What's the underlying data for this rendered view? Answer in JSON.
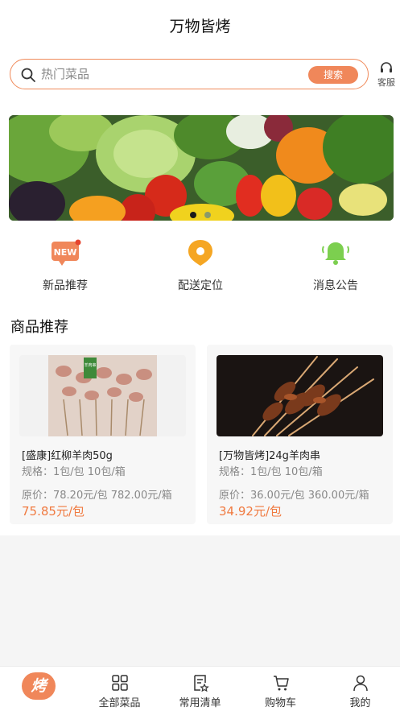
{
  "header": {
    "title": "万物皆烤"
  },
  "search": {
    "placeholder": "热门菜品",
    "button_label": "搜索",
    "service_label": "客服"
  },
  "banner": {
    "pages": 2,
    "active_page": 1
  },
  "quick_links": [
    {
      "label": "新品推荐",
      "icon": "new-badge-icon",
      "badge_text": "NEW"
    },
    {
      "label": "配送定位",
      "icon": "location-pin-icon"
    },
    {
      "label": "消息公告",
      "icon": "bell-icon"
    }
  ],
  "section": {
    "title": "商品推荐"
  },
  "products": [
    {
      "name": "[盛康]红柳羊肉50g",
      "spec": "规格：1包/包 10包/箱",
      "original_price": "原价：78.20元/包 782.00元/箱",
      "price": "75.85元/包",
      "package_tag": "羊肉串"
    },
    {
      "name": "[万物皆烤]24g羊肉串",
      "spec": "规格：1包/包 10包/箱",
      "original_price": "原价：36.00元/包 360.00元/箱",
      "price": "34.92元/包"
    }
  ],
  "tabbar": {
    "logo_text": "烤",
    "items": [
      {
        "label": "全部菜品",
        "icon": "grid-icon"
      },
      {
        "label": "常用清单",
        "icon": "list-star-icon"
      },
      {
        "label": "购物车",
        "icon": "cart-icon"
      },
      {
        "label": "我的",
        "icon": "user-icon"
      }
    ]
  },
  "colors": {
    "accent": "#f0875a",
    "price": "#f07a40",
    "bell": "#7ccf4f",
    "pin": "#f5a623"
  }
}
